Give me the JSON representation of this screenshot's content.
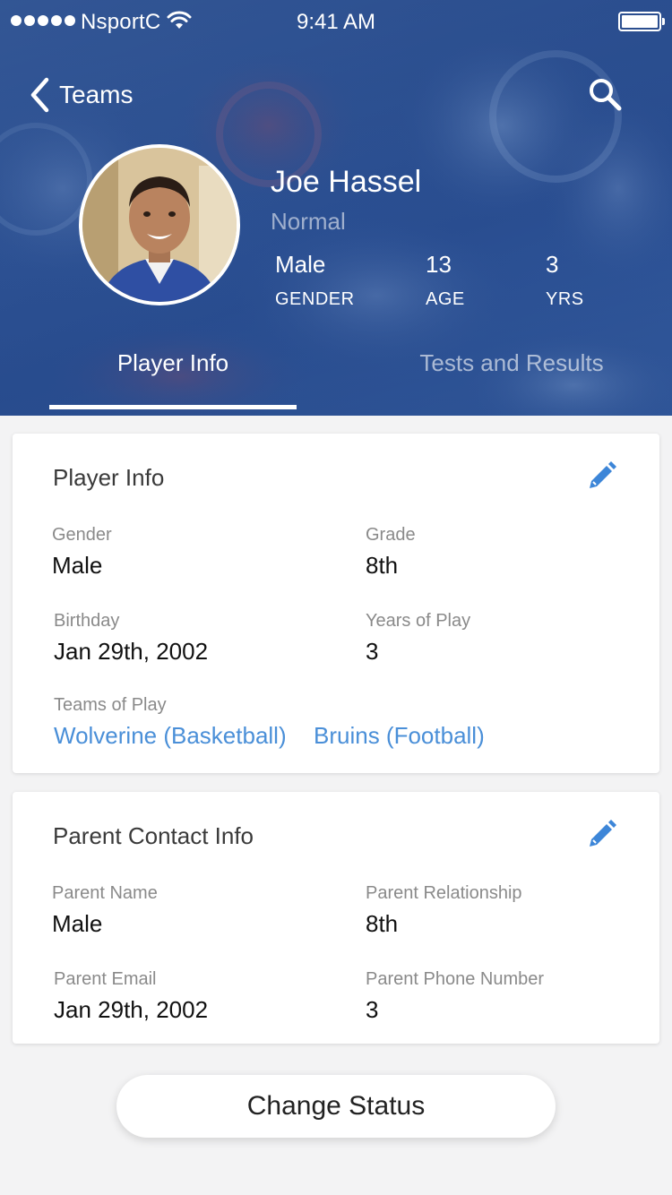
{
  "status_bar": {
    "carrier": "NsportC",
    "time": "9:41 AM"
  },
  "nav": {
    "back_label": "Teams",
    "back_icon": "chevron-left-icon",
    "search_icon": "search-icon"
  },
  "profile": {
    "name": "Joe Hassel",
    "status": "Normal",
    "stats": [
      {
        "value": "Male",
        "label": "GENDER"
      },
      {
        "value": "13",
        "label": "AGE"
      },
      {
        "value": "3",
        "label": "YRS"
      }
    ]
  },
  "tabs": [
    {
      "label": "Player Info",
      "active": true
    },
    {
      "label": "Tests and Results",
      "active": false
    }
  ],
  "player_info": {
    "title": "Player Info",
    "fields": [
      {
        "label": "Gender",
        "value": "Male"
      },
      {
        "label": "Grade",
        "value": "8th"
      },
      {
        "label": "Birthday",
        "value": "Jan 29th, 2002"
      },
      {
        "label": "Years of Play",
        "value": "3"
      }
    ],
    "teams_label": "Teams of Play",
    "teams": [
      "Wolverine (Basketball)",
      "Bruins (Football)"
    ]
  },
  "parent_info": {
    "title": "Parent Contact Info",
    "fields": [
      {
        "label": "Parent Name",
        "value": "Male"
      },
      {
        "label": "Parent Relationship",
        "value": "8th"
      },
      {
        "label": "Parent Email",
        "value": "Jan 29th, 2002"
      },
      {
        "label": "Parent Phone Number",
        "value": "3"
      }
    ]
  },
  "action": {
    "label": "Change Status"
  },
  "colors": {
    "accent": "#4a8fd8",
    "header": "#2f5496",
    "background": "#f3f3f4"
  }
}
